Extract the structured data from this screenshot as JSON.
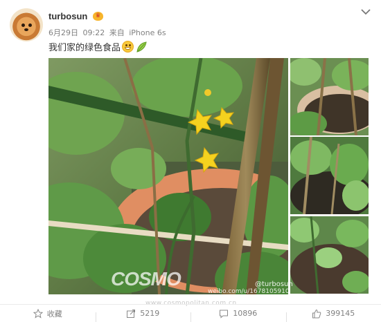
{
  "user": {
    "name": "turbosun",
    "badge_icon": "vip-badge-icon"
  },
  "meta": {
    "date": "6月29日",
    "time": "09:22",
    "source_prefix": "来自",
    "device": "iPhone 6s"
  },
  "post": {
    "text": "我们家的绿色食品"
  },
  "watermarks": {
    "brand": "COSMO",
    "user_tag": "@turbosun",
    "url": "weibo.com/u/1678105910",
    "site": "www.cosmopolitan.com.cn"
  },
  "actions": [
    {
      "label": "收藏",
      "icon": "star-icon"
    },
    {
      "label": "5219",
      "icon": "share-icon"
    },
    {
      "label": "10896",
      "icon": "comment-icon"
    },
    {
      "label": "399145",
      "icon": "like-icon"
    }
  ],
  "colors": {
    "text": "#333333",
    "muted": "#808080",
    "accent": "#f7b52c"
  }
}
